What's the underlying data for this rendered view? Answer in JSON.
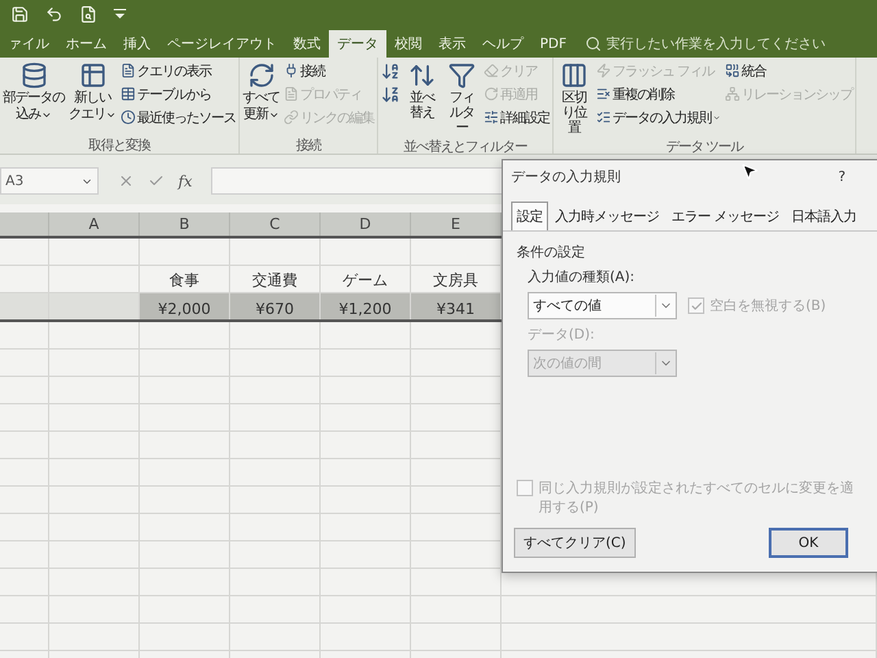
{
  "tabs": [
    {
      "label": "ァイル",
      "selected": false
    },
    {
      "label": "ホーム",
      "selected": false
    },
    {
      "label": "挿入",
      "selected": false
    },
    {
      "label": "ページレイアウト",
      "selected": false
    },
    {
      "label": "数式",
      "selected": false
    },
    {
      "label": "データ",
      "selected": true
    },
    {
      "label": "校閲",
      "selected": false
    },
    {
      "label": "表示",
      "selected": false
    },
    {
      "label": "ヘルプ",
      "selected": false
    },
    {
      "label": "PDF",
      "selected": false
    }
  ],
  "search": {
    "placeholder": "実行したい作業を入力してください"
  },
  "ribbon": [
    {
      "label": "取得と変換",
      "items": [
        {
          "lines": [
            "部データの",
            "込み"
          ],
          "kind": "large",
          "disabled": false,
          "dropdown": true
        },
        {
          "lines": [
            "新しい",
            "クエリ"
          ],
          "kind": "large",
          "disabled": false,
          "dropdown": true
        },
        {
          "label": "クエリの表示",
          "kind": "small",
          "disabled": false,
          "dropdown": false
        },
        {
          "label": "テーブルから",
          "kind": "small",
          "disabled": false,
          "dropdown": false
        },
        {
          "label": "最近使ったソース",
          "kind": "small",
          "disabled": false,
          "dropdown": false
        }
      ]
    },
    {
      "label": "接続",
      "items": [
        {
          "lines": [
            "すべて",
            "更新"
          ],
          "kind": "large",
          "disabled": false,
          "dropdown": true
        },
        {
          "label": "接続",
          "kind": "small",
          "disabled": false,
          "dropdown": false
        },
        {
          "label": "プロパティ",
          "kind": "small",
          "disabled": true,
          "dropdown": false
        },
        {
          "label": "リンクの編集",
          "kind": "small",
          "disabled": true,
          "dropdown": false
        }
      ]
    },
    {
      "label": "並べ替えとフィルター",
      "items": [
        {
          "kind": "icon",
          "disabled": false,
          "dropdown": false
        },
        {
          "kind": "icon",
          "disabled": false,
          "dropdown": false
        },
        {
          "label": "並べ替え",
          "kind": "large",
          "disabled": false,
          "dropdown": false
        },
        {
          "label": "フィルター",
          "kind": "large",
          "disabled": false,
          "dropdown": false
        },
        {
          "label": "クリア",
          "kind": "small",
          "disabled": true,
          "dropdown": false
        },
        {
          "label": "再適用",
          "kind": "small",
          "disabled": true,
          "dropdown": false
        },
        {
          "label": "詳細設定",
          "kind": "small",
          "disabled": false,
          "dropdown": false
        }
      ]
    },
    {
      "label": "データ ツール",
      "items": [
        {
          "label": "区切り位置",
          "kind": "large",
          "disabled": false,
          "dropdown": false
        },
        {
          "label": "フラッシュ フィル",
          "kind": "small",
          "disabled": true,
          "dropdown": false
        },
        {
          "label": "重複の削除",
          "kind": "small",
          "disabled": false,
          "dropdown": false
        },
        {
          "label": "データの入力規則",
          "kind": "small",
          "disabled": false,
          "dropdown": true
        },
        {
          "label": "統合",
          "kind": "small",
          "disabled": false,
          "dropdown": false
        },
        {
          "label": "リレーションシップ",
          "kind": "small",
          "disabled": true,
          "dropdown": false
        }
      ]
    }
  ],
  "formula_bar": {
    "name_box": "A3",
    "function_label": "fx"
  },
  "sheet": {
    "columns": [
      "A",
      "B",
      "C",
      "D",
      "E"
    ],
    "rows": [
      {
        "cells": [
          null,
          null,
          null,
          null,
          null
        ],
        "selected": false
      },
      {
        "cells": [
          null,
          "食事",
          "交通費",
          "ゲーム",
          "文房具"
        ],
        "selected": false
      },
      {
        "cells": [
          null,
          "¥2,000",
          "¥670",
          "¥1,200",
          "¥341"
        ],
        "selected": true
      }
    ]
  },
  "dialog": {
    "title": "データの入力規則",
    "help": "?",
    "tabs": [
      {
        "label": "設定",
        "selected": true
      },
      {
        "label": "入力時メッセージ",
        "selected": false
      },
      {
        "label": "エラー メッセージ",
        "selected": false
      },
      {
        "label": "日本語入力",
        "selected": false
      }
    ],
    "section": "条件の設定",
    "fields": [
      {
        "label": "入力値の種類(A):",
        "value": "すべての値",
        "disabled": false
      },
      {
        "label": "データ(D):",
        "value": "次の値の間",
        "disabled": true
      }
    ],
    "ignore_blank": {
      "label": "空白を無視する(B)",
      "checked": true,
      "disabled": true
    },
    "apply_all": {
      "label": "同じ入力規則が設定されたすべてのセルに変更を適用する(P)",
      "checked": false,
      "disabled": true
    },
    "buttons": [
      {
        "label": "すべてクリア(C)",
        "default": false
      },
      {
        "label": "OK",
        "default": true
      }
    ]
  }
}
